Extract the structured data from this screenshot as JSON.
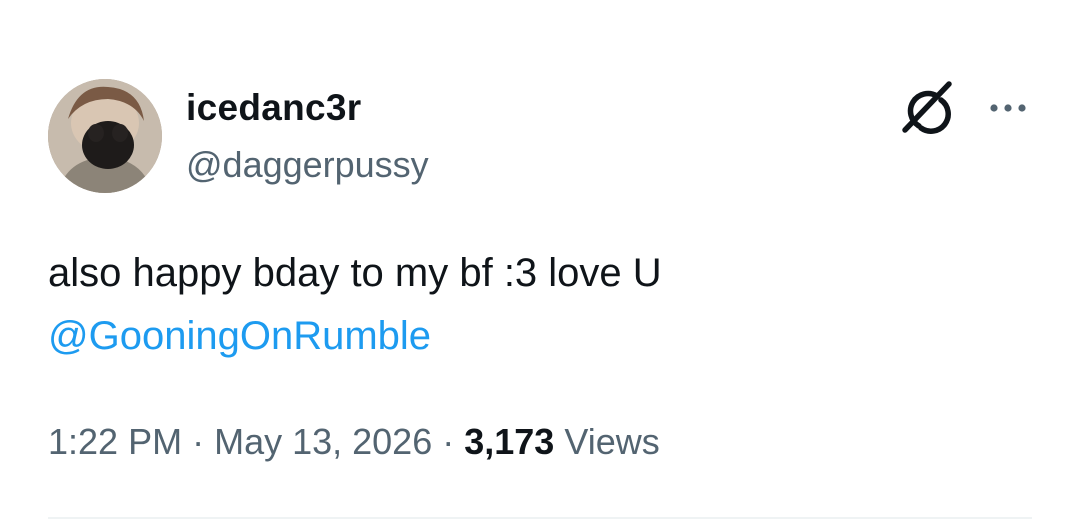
{
  "author": {
    "display_name": "icedanc3r",
    "handle": "@daggerpussy"
  },
  "tweet": {
    "text": "also happy bday to my bf :3 love U",
    "mention": "@GooningOnRumble"
  },
  "meta": {
    "time": "1:22 PM",
    "separator": "·",
    "date": "May 13, 2026",
    "views_count": "3,173",
    "views_label": "Views"
  },
  "icons": {
    "grok": "grok-icon",
    "more": "more-dots-icon"
  },
  "colors": {
    "link": "#1d9bf0",
    "secondary_text": "#536471",
    "primary_text": "#0f1419"
  }
}
